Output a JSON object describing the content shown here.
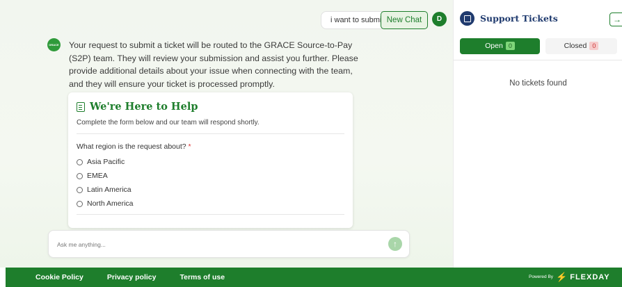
{
  "chat": {
    "user_message": "i want to submit a",
    "new_chat_label": "New Chat",
    "user_avatar": "D",
    "bot_avatar": "GRACE",
    "bot_message": "Your request to submit a ticket will be routed to the GRACE Source-to-Pay (S2P) team. They will review your submission and assist you further. Please provide additional details about your issue when connecting with the team, and they will ensure your ticket is processed promptly."
  },
  "form_card": {
    "icon": "clipboard-icon",
    "title": "We're Here to Help",
    "subtitle": "Complete the form below and our team will respond shortly.",
    "question": "What region is the request about?",
    "required_mark": "*",
    "options": [
      "Asia Pacific",
      "EMEA",
      "Latin America",
      "North America"
    ]
  },
  "input": {
    "placeholder": "Ask me anything...",
    "value": ""
  },
  "panel": {
    "title": "Support Tickets",
    "collapse_icon": "→",
    "tabs": [
      {
        "label": "Open",
        "count": "0"
      },
      {
        "label": "Closed",
        "count": "0"
      }
    ],
    "empty_text": "No tickets found"
  },
  "footer": {
    "links": [
      "Cookie Policy",
      "Privacy policy",
      "Terms of use"
    ],
    "powered_by": "Powered By",
    "brand": "FLEXDAY"
  },
  "colors": {
    "brand_green": "#1e7e2c",
    "panel_title_navy": "#1f3a6e"
  }
}
